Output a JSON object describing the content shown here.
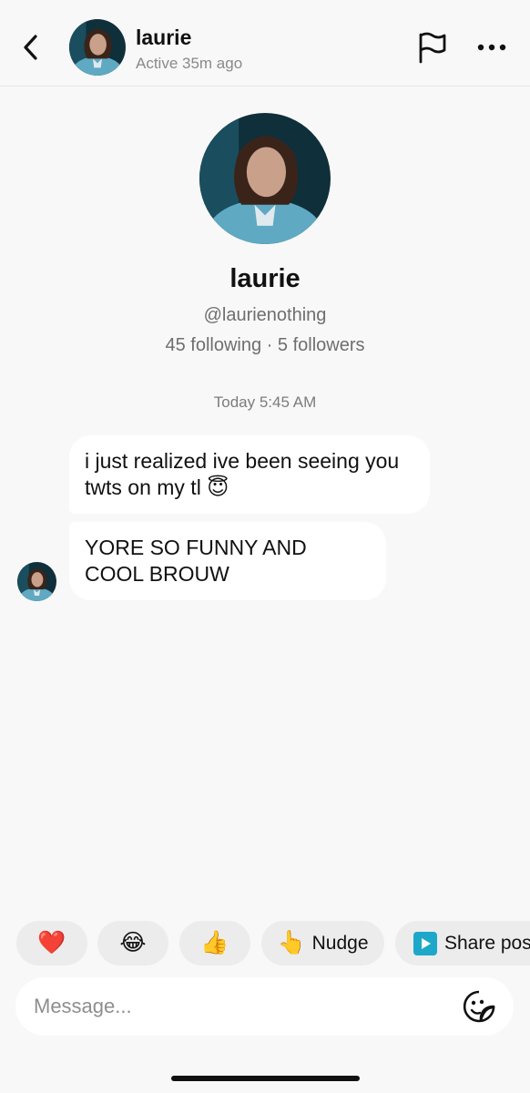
{
  "header": {
    "name": "laurie",
    "status": "Active 35m ago",
    "icons": {
      "back": "back-chevron-icon",
      "report": "flag-icon",
      "more": "more-dots-icon"
    }
  },
  "profile": {
    "name": "laurie",
    "handle": "@laurienothing",
    "stats": "45 following · 5 followers"
  },
  "conversation": {
    "timestamp": "Today 5:45 AM",
    "messages": [
      {
        "text": "i just realized ive been seeing you twts on my tl 😇"
      },
      {
        "text": "YORE SO FUNNY AND COOL BROUW"
      }
    ]
  },
  "quick_replies": [
    {
      "icon": "❤️",
      "label": ""
    },
    {
      "icon": "😂",
      "label": ""
    },
    {
      "icon": "👍",
      "label": ""
    },
    {
      "icon": "👆",
      "label": "Nudge"
    },
    {
      "icon": "▶",
      "label": "Share pos"
    }
  ],
  "composer": {
    "placeholder": "Message...",
    "value": "",
    "sticker_icon": "sticker-face-icon"
  },
  "colors": {
    "background": "#f8f8f8",
    "bubble": "#ffffff",
    "chip": "#ececec",
    "share_icon": "#1da8c9",
    "muted_text": "#8a8a8a"
  }
}
